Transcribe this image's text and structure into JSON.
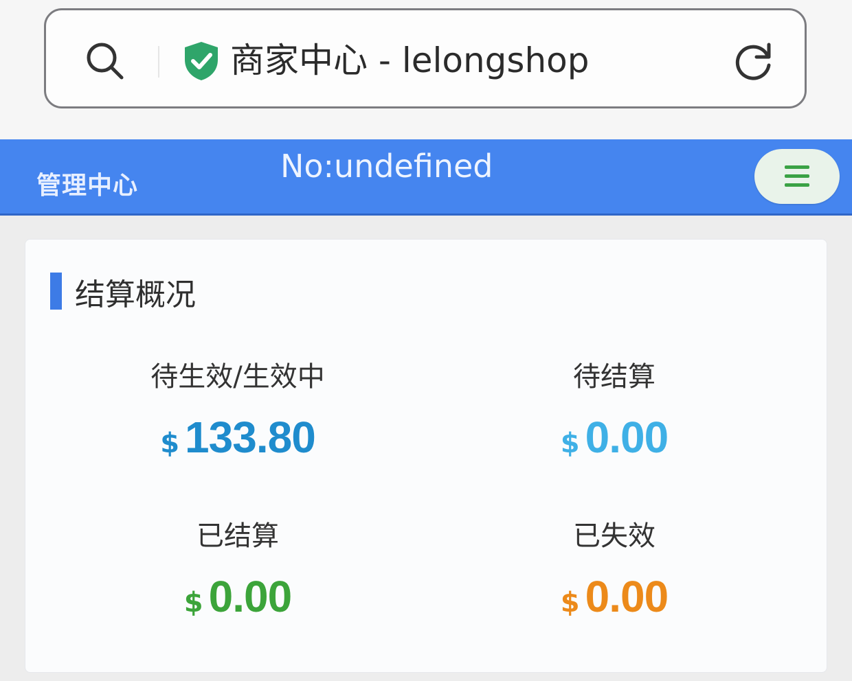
{
  "browser": {
    "title": "商家中心 - lelongshop",
    "icons": {
      "search": "search-icon",
      "secure": "shield-check-icon",
      "reload": "reload-icon"
    }
  },
  "header": {
    "left_label": "管理中心",
    "title": "No:undefined",
    "menu_icon": "hamburger-menu-icon",
    "colors": {
      "background": "#4585ef",
      "menu_accent": "#3aa245"
    }
  },
  "settlement": {
    "title": "结算概况",
    "accent_color": "#3d7be6",
    "stats": [
      {
        "label": "待生效/生效中",
        "currency": "$",
        "amount": "133.80",
        "color": "#1f8ccd"
      },
      {
        "label": "待结算",
        "currency": "$",
        "amount": "0.00",
        "color": "#3fb0e6"
      },
      {
        "label": "已结算",
        "currency": "$",
        "amount": "0.00",
        "color": "#3ca43a"
      },
      {
        "label": "已失效",
        "currency": "$",
        "amount": "0.00",
        "color": "#ec8a1a"
      }
    ]
  }
}
